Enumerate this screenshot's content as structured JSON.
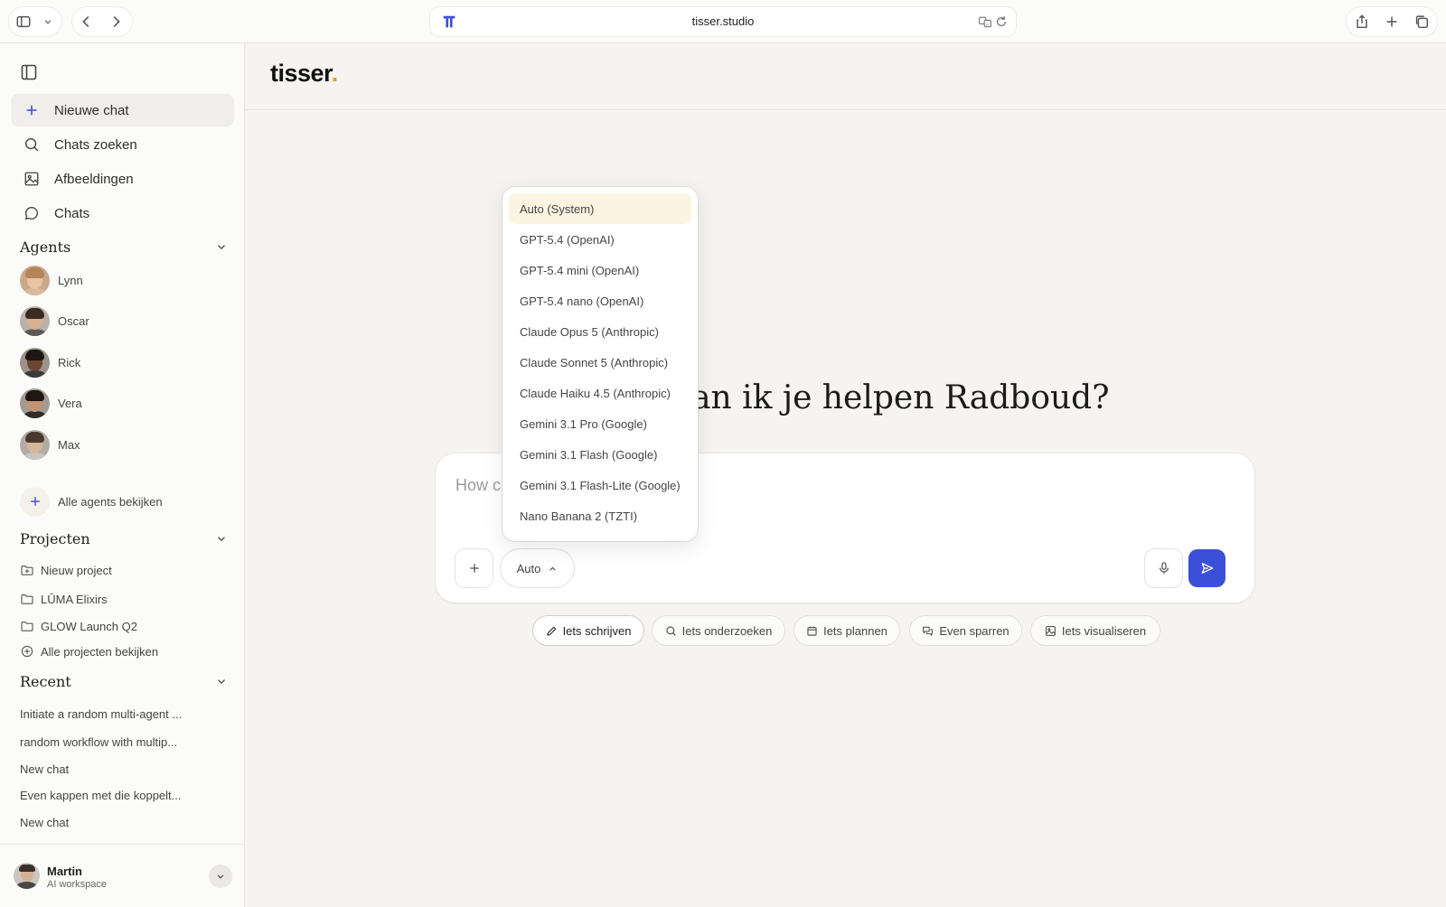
{
  "browser": {
    "url": "tisser.studio"
  },
  "sidebar": {
    "nav": [
      {
        "label": "Nieuwe chat",
        "icon": "plus-icon"
      },
      {
        "label": "Chats zoeken",
        "icon": "search-icon"
      },
      {
        "label": "Afbeeldingen",
        "icon": "image-icon"
      },
      {
        "label": "Chats",
        "icon": "chat-bubble-icon"
      }
    ],
    "agents_title": "Agents",
    "agents": [
      {
        "name": "Lynn",
        "skin": "#e8c4a4",
        "hair": "#b58559",
        "shirt": "#d9b99b",
        "bg": "#c9a98a"
      },
      {
        "name": "Oscar",
        "skin": "#d6b193",
        "hair": "#3a2c22",
        "shirt": "#5d5a55",
        "bg": "#b8b2aa"
      },
      {
        "name": "Rick",
        "skin": "#6a4532",
        "hair": "#1e1612",
        "shirt": "#3c3a38",
        "bg": "#9b938a"
      },
      {
        "name": "Vera",
        "skin": "#c49276",
        "hair": "#1f1712",
        "shirt": "#2f2b28",
        "bg": "#a39a91"
      },
      {
        "name": "Max",
        "skin": "#d7b59a",
        "hair": "#4a3a2e",
        "shirt": "#c9c5c0",
        "bg": "#b3aca4"
      }
    ],
    "all_agents": "Alle agents bekijken",
    "projects_title": "Projecten",
    "projects": [
      {
        "label": "Nieuw project",
        "icon": "folder-plus-icon"
      },
      {
        "label": "LŪMA Elixirs",
        "icon": "folder-icon"
      },
      {
        "label": "GLOW Launch Q2",
        "icon": "folder-icon"
      },
      {
        "label": "Alle projecten bekijken",
        "icon": "plus-circle-icon"
      }
    ],
    "recent_title": "Recent",
    "recent": [
      "Initiate a random multi-agent ...",
      "random workflow with multip...",
      "New chat",
      "Even kappen met die koppelt...",
      "New chat"
    ],
    "user": {
      "name": "Martin",
      "subtitle": "AI workspace"
    }
  },
  "main": {
    "logo": "tisser",
    "logo_dot": ".",
    "greeting": "Hoe kan ik je helpen Radboud?",
    "composer": {
      "placeholder": "How can I help you today?",
      "model_label": "Auto"
    },
    "chips": [
      {
        "label": "Iets schrijven",
        "icon": "pencil-icon"
      },
      {
        "label": "Iets onderzoeken",
        "icon": "search-icon"
      },
      {
        "label": "Iets plannen",
        "icon": "calendar-icon"
      },
      {
        "label": "Even sparren",
        "icon": "chat-bubbles-icon"
      },
      {
        "label": "Iets visualiseren",
        "icon": "image-icon"
      }
    ]
  },
  "model_dropdown": {
    "selected_index": 0,
    "options": [
      "Auto (System)",
      "GPT-5.4 (OpenAI)",
      "GPT-5.4 mini (OpenAI)",
      "GPT-5.4 nano (OpenAI)",
      "Claude Opus 5 (Anthropic)",
      "Claude Sonnet 5 (Anthropic)",
      "Claude Haiku 4.5 (Anthropic)",
      "Gemini 3.1 Pro (Google)",
      "Gemini 3.1 Flash (Google)",
      "Gemini 3.1 Flash-Lite (Google)",
      "Nano Banana 2 (TZTI)"
    ]
  },
  "colors": {
    "accent": "#3c4fd8",
    "logo_dot": "#d7a214",
    "selected_option_bg": "#fbf4e1"
  }
}
